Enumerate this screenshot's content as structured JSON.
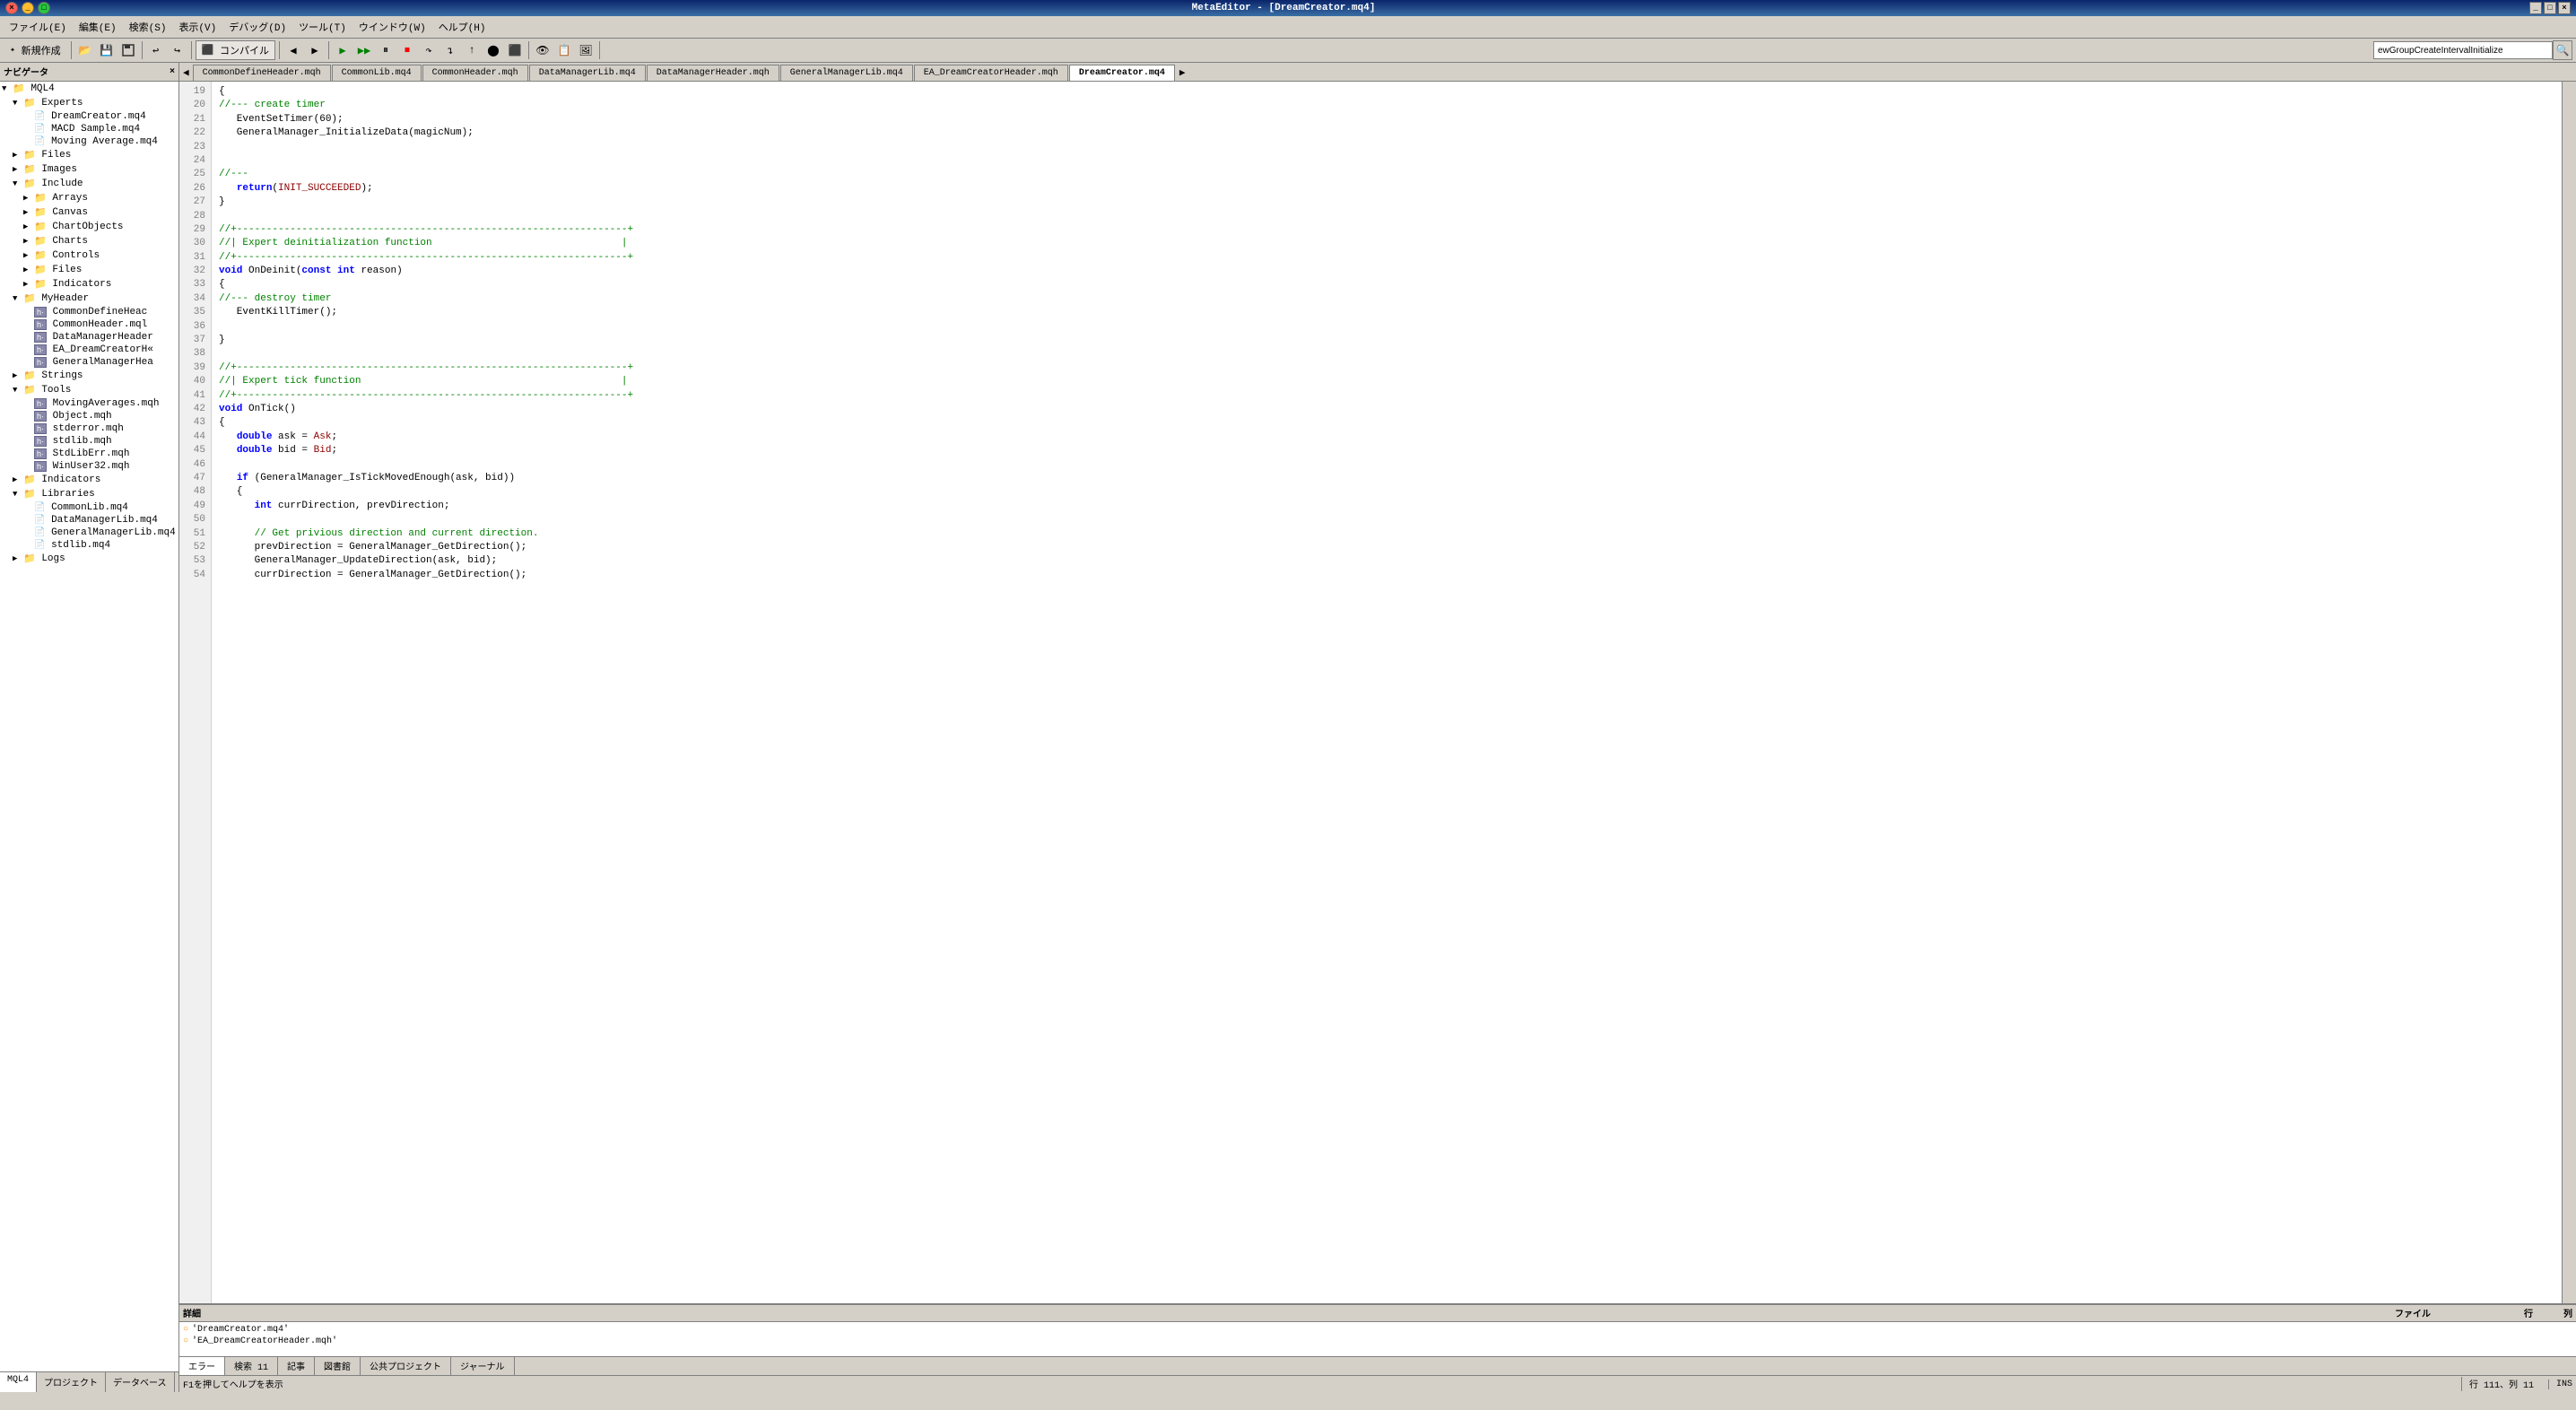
{
  "window": {
    "title": "MetaEditor - [DreamCreator.mq4]",
    "controls": [
      "_",
      "□",
      "×"
    ]
  },
  "menu": {
    "items": [
      "ファイル(E)",
      "編集(E)",
      "検索(S)",
      "表示(V)",
      "デバッグ(D)",
      "ツール(T)",
      "ウインドウ(W)",
      "ヘルプ(H)"
    ]
  },
  "toolbar": {
    "new_label": "✦ 新規作成",
    "search_placeholder": "ewGroupCreateIntervalInitialize",
    "compile_label": "コンパイル"
  },
  "tabs": {
    "items": [
      "CommonDefineHeader.mqh",
      "CommonLib.mq4",
      "CommonHeader.mqh",
      "DataManagerLib.mq4",
      "DataManagerHeader.mqh",
      "GeneralManagerLib.mq4",
      "EA_DreamCreatorHeader.mqh",
      "DreamCreator.mq4"
    ],
    "active": "DreamCreator.mq4"
  },
  "sidebar": {
    "header": "ナビゲータ",
    "tree": [
      {
        "level": 0,
        "toggle": "▼",
        "icon": "📁",
        "label": "MQL4",
        "type": "folder"
      },
      {
        "level": 1,
        "toggle": "▼",
        "icon": "📁",
        "label": "Experts",
        "type": "folder"
      },
      {
        "level": 2,
        "toggle": " ",
        "icon": "📄",
        "label": "DreamCreator.mq4",
        "type": "file"
      },
      {
        "level": 2,
        "toggle": " ",
        "icon": "📄",
        "label": "MACD Sample.mq4",
        "type": "file"
      },
      {
        "level": 2,
        "toggle": " ",
        "icon": "📄",
        "label": "Moving Average.mq4",
        "type": "file"
      },
      {
        "level": 1,
        "toggle": "▶",
        "icon": "📁",
        "label": "Files",
        "type": "folder"
      },
      {
        "level": 1,
        "toggle": "▶",
        "icon": "📁",
        "label": "Images",
        "type": "folder"
      },
      {
        "level": 1,
        "toggle": "▼",
        "icon": "📁",
        "label": "Include",
        "type": "folder"
      },
      {
        "level": 2,
        "toggle": "▶",
        "icon": "📁",
        "label": "Arrays",
        "type": "folder"
      },
      {
        "level": 2,
        "toggle": "▶",
        "icon": "📁",
        "label": "Canvas",
        "type": "folder"
      },
      {
        "level": 2,
        "toggle": "▶",
        "icon": "📁",
        "label": "ChartObjects",
        "type": "folder"
      },
      {
        "level": 2,
        "toggle": "▶",
        "icon": "📁",
        "label": "Charts",
        "type": "folder"
      },
      {
        "level": 2,
        "toggle": "▶",
        "icon": "📁",
        "label": "Controls",
        "type": "folder"
      },
      {
        "level": 2,
        "toggle": "▶",
        "icon": "📁",
        "label": "Files",
        "type": "folder"
      },
      {
        "level": 2,
        "toggle": "▶",
        "icon": "📁",
        "label": "Indicators",
        "type": "folder"
      },
      {
        "level": 1,
        "toggle": "▼",
        "icon": "📁",
        "label": "MyHeader",
        "type": "folder"
      },
      {
        "level": 2,
        "toggle": " ",
        "icon": "h",
        "label": "CommonDefineHeac",
        "type": "h-file"
      },
      {
        "level": 2,
        "toggle": " ",
        "icon": "h",
        "label": "CommonHeader.mql",
        "type": "h-file"
      },
      {
        "level": 2,
        "toggle": " ",
        "icon": "h",
        "label": "DataManagerHeader",
        "type": "h-file"
      },
      {
        "level": 2,
        "toggle": " ",
        "icon": "h",
        "label": "EA_DreamCreatorH«",
        "type": "h-file"
      },
      {
        "level": 2,
        "toggle": " ",
        "icon": "h",
        "label": "GeneralManagerHea",
        "type": "h-file"
      },
      {
        "level": 1,
        "toggle": "▶",
        "icon": "📁",
        "label": "Strings",
        "type": "folder"
      },
      {
        "level": 1,
        "toggle": "▼",
        "icon": "📁",
        "label": "Tools",
        "type": "folder"
      },
      {
        "level": 2,
        "toggle": " ",
        "icon": "h",
        "label": "MovingAverages.mqh",
        "type": "h-file"
      },
      {
        "level": 2,
        "toggle": " ",
        "icon": "h",
        "label": "Object.mqh",
        "type": "h-file"
      },
      {
        "level": 2,
        "toggle": " ",
        "icon": "h",
        "label": "stderror.mqh",
        "type": "h-file"
      },
      {
        "level": 2,
        "toggle": " ",
        "icon": "h",
        "label": "stdlib.mqh",
        "type": "h-file"
      },
      {
        "level": 2,
        "toggle": " ",
        "icon": "h",
        "label": "StdLibErr.mqh",
        "type": "h-file"
      },
      {
        "level": 2,
        "toggle": " ",
        "icon": "h",
        "label": "WinUser32.mqh",
        "type": "h-file"
      },
      {
        "level": 1,
        "toggle": "▶",
        "icon": "📁",
        "label": "Indicators",
        "type": "folder"
      },
      {
        "level": 1,
        "toggle": "▼",
        "icon": "📁",
        "label": "Libraries",
        "type": "folder"
      },
      {
        "level": 2,
        "toggle": " ",
        "icon": "📄",
        "label": "CommonLib.mq4",
        "type": "file"
      },
      {
        "level": 2,
        "toggle": " ",
        "icon": "📄",
        "label": "DataManagerLib.mq4",
        "type": "file"
      },
      {
        "level": 2,
        "toggle": " ",
        "icon": "📄",
        "label": "GeneralManagerLib.mq4",
        "type": "file"
      },
      {
        "level": 2,
        "toggle": " ",
        "icon": "📄",
        "label": "stdlib.mq4",
        "type": "file"
      },
      {
        "level": 1,
        "toggle": "▶",
        "icon": "📁",
        "label": "Logs",
        "type": "folder"
      }
    ],
    "tabs": [
      "MQL4",
      "プロジェクト",
      "データベース"
    ]
  },
  "code": {
    "lines": [
      {
        "num": 19,
        "content": "{"
      },
      {
        "num": 20,
        "content": "//--- create timer"
      },
      {
        "num": 21,
        "content": "   EventSetTimer(60);"
      },
      {
        "num": 22,
        "content": "   GeneralManager_InitializeData(magicNum);"
      },
      {
        "num": 23,
        "content": ""
      },
      {
        "num": 24,
        "content": ""
      },
      {
        "num": 25,
        "content": "//---"
      },
      {
        "num": 26,
        "content": "   return(INIT_SUCCEEDED);"
      },
      {
        "num": 27,
        "content": "}"
      },
      {
        "num": 28,
        "content": ""
      },
      {
        "num": 29,
        "content": "//+------------------------------------------------------------------+"
      },
      {
        "num": 30,
        "content": "//| Expert deinitialization function                                |"
      },
      {
        "num": 31,
        "content": "//+------------------------------------------------------------------+"
      },
      {
        "num": 32,
        "content": "void OnDeinit(const int reason)"
      },
      {
        "num": 33,
        "content": "{"
      },
      {
        "num": 34,
        "content": "//--- destroy timer"
      },
      {
        "num": 35,
        "content": "   EventKillTimer();"
      },
      {
        "num": 36,
        "content": ""
      },
      {
        "num": 37,
        "content": "}"
      },
      {
        "num": 38,
        "content": ""
      },
      {
        "num": 39,
        "content": "//+------------------------------------------------------------------+"
      },
      {
        "num": 40,
        "content": "//| Expert tick function                                            |"
      },
      {
        "num": 41,
        "content": "//+------------------------------------------------------------------+"
      },
      {
        "num": 42,
        "content": "void OnTick()"
      },
      {
        "num": 43,
        "content": "{"
      },
      {
        "num": 44,
        "content": "   double ask = Ask;"
      },
      {
        "num": 45,
        "content": "   double bid = Bid;"
      },
      {
        "num": 46,
        "content": ""
      },
      {
        "num": 47,
        "content": "   if (GeneralManager_IsTickMovedEnough(ask, bid))"
      },
      {
        "num": 48,
        "content": "   {"
      },
      {
        "num": 49,
        "content": "      int currDirection, prevDirection;"
      },
      {
        "num": 50,
        "content": ""
      },
      {
        "num": 51,
        "content": "      // Get privious direction and current direction."
      },
      {
        "num": 52,
        "content": "      prevDirection = GeneralManager_GetDirection();"
      },
      {
        "num": 53,
        "content": "      GeneralManager_UpdateDirection(ask, bid);"
      },
      {
        "num": 54,
        "content": "      currDirection = GeneralManager_GetDirection();"
      }
    ]
  },
  "bottom_panel": {
    "header": "詳細",
    "col_headers": [
      "",
      "ファイル",
      "行",
      "列"
    ],
    "rows": [
      {
        "icon": "○",
        "text": "'DreamCreator.mq4'"
      },
      {
        "icon": "○",
        "text": "'EA_DreamCreatorHeader.mqh'"
      }
    ],
    "tabs": [
      "エラー",
      "検索",
      "記事",
      "図書館",
      "公共プロジェクト",
      "ジャーナル"
    ]
  },
  "status_bar": {
    "help_text": "F1を押してヘルプを表示",
    "position": "行 111、列 11",
    "mode": "INS"
  }
}
